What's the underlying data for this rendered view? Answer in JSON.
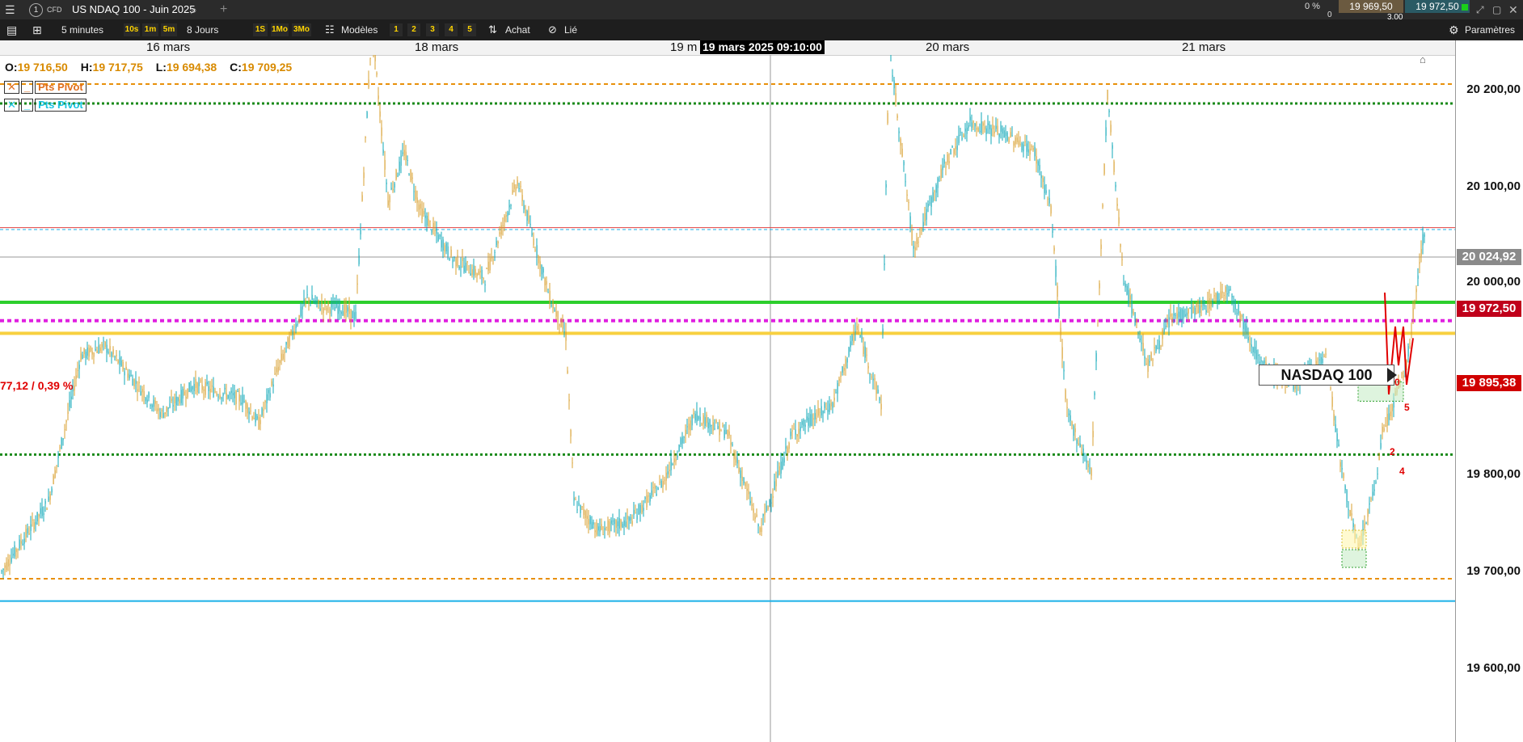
{
  "titlebar": {
    "tab_number": "1",
    "instrument_type": "CFD",
    "instrument_name": "US NDAQ 100 - Juin 2025",
    "position_pct": "0 %",
    "position_qty": "0",
    "bid": "19 969,50",
    "ask": "19 972,50",
    "spread": "3,00"
  },
  "toolbar": {
    "timeframe": "5 minutes",
    "tf_buttons": [
      "10s",
      "1m",
      "5m"
    ],
    "period": "8 Jours",
    "range_buttons": [
      "1S",
      "1Mo",
      "3Mo"
    ],
    "models_label": "Modèles",
    "layout_buttons": [
      "1",
      "2",
      "3",
      "4",
      "5"
    ],
    "buy_label": "Achat",
    "linked_label": "Lié",
    "settings_label": "Paramètres"
  },
  "dates": [
    "16 mars",
    "18 mars",
    "19 m",
    "20 mars",
    "21 mars"
  ],
  "crosshair_time": "19 mars 2025 09:10:00",
  "ohlc": {
    "o_label": "O:",
    "o": "19 716,50",
    "h_label": "H:",
    "h": "19 717,75",
    "l_label": "L:",
    "l": "19 694,38",
    "c_label": "C:",
    "c": "19 709,25"
  },
  "indicators": [
    {
      "close": "✕",
      "minimize": "_",
      "name": "Pts Pivot",
      "color": "#e07020"
    },
    {
      "close": "✕",
      "minimize": "_",
      "name": "Pts Pivot",
      "color": "#19c4e0"
    }
  ],
  "change_label": "77,12 / 0,39 %",
  "symbol_label": "NASDAQ 100",
  "pattern_labels": [
    "0",
    "2",
    "4",
    "5"
  ],
  "price_axis": [
    "20 200,00",
    "20 100,00",
    "20 000,00",
    "19 800,00",
    "19 700,00",
    "19 600,00"
  ],
  "price_tags": [
    {
      "value": "20 024,92",
      "bg": "#8a8a8a"
    },
    {
      "value": "19 972,50",
      "bg": "#c0001a"
    },
    {
      "value": "19 895,38",
      "bg": "#d00000"
    }
  ],
  "colors": {
    "candle_up": "#12a8b8",
    "candle_down": "#d8a030",
    "pivot_orange": "#e8900a",
    "pivot_green": "#1a8a1a",
    "solid_green": "#2ccf2c",
    "magenta": "#e020e0",
    "yellow": "#f8d040",
    "cyan_line": "#1ab0e8",
    "red_line": "#e04040"
  }
}
